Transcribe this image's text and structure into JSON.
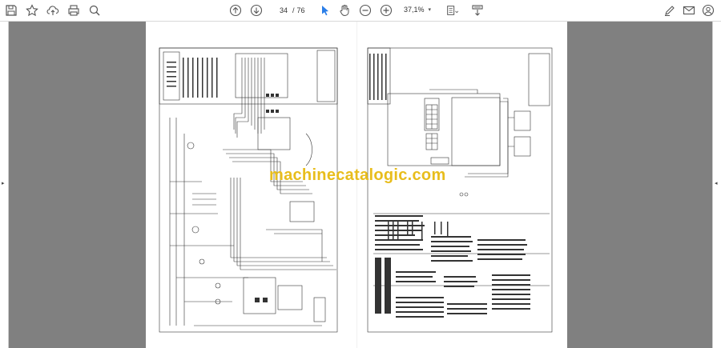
{
  "toolbar": {
    "current_page": "34",
    "page_separator": "/",
    "total_pages": "76",
    "zoom": "37,1%"
  },
  "watermark": "machinecatalogic.com",
  "colors": {
    "viewer_gray": "#808080",
    "watermark": "#e8bd1c",
    "select_tool": "#2a7ee8"
  }
}
